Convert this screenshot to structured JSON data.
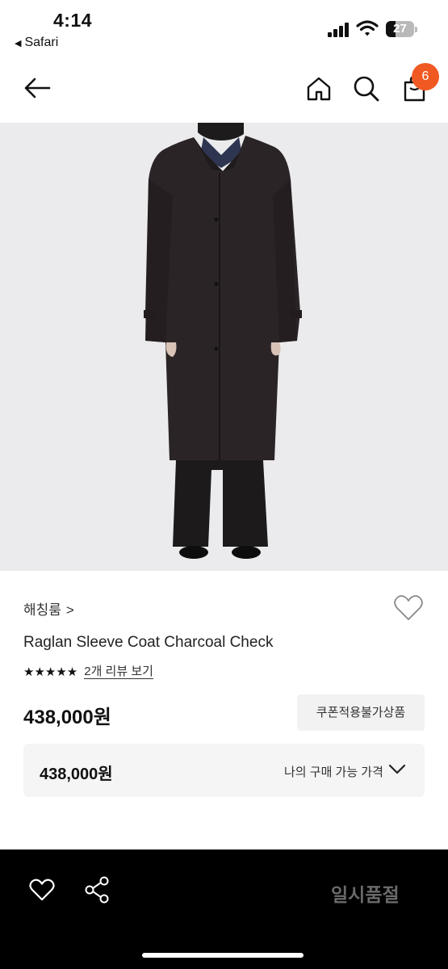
{
  "status_bar": {
    "time": "4:14",
    "back_app": "Safari",
    "battery": "27"
  },
  "nav": {
    "cart_count": "6",
    "icons": [
      "back-arrow-icon",
      "home-icon",
      "search-icon",
      "cart-bag-icon"
    ]
  },
  "product": {
    "shop_name": "해칭룸",
    "shop_chevron": ">",
    "name": "Raglan Sleeve Coat Charcoal Check",
    "stars": "★★★★★",
    "review_link": "2개 리뷰 보기",
    "price": "438,000원",
    "coupon_label": "쿠폰적용불가상품",
    "purchasable_price": "438,000원",
    "purchasable_label": "나의 구매 가능 가격"
  },
  "bottom_bar": {
    "soldout_label": "일시품절",
    "icons": [
      "heart-icon",
      "share-icon"
    ]
  },
  "colors": {
    "accent_badge": "#f05a22",
    "hero_bg": "#ebebed",
    "bottom_bg": "#000000",
    "soldout_text": "#6a6a6a"
  }
}
